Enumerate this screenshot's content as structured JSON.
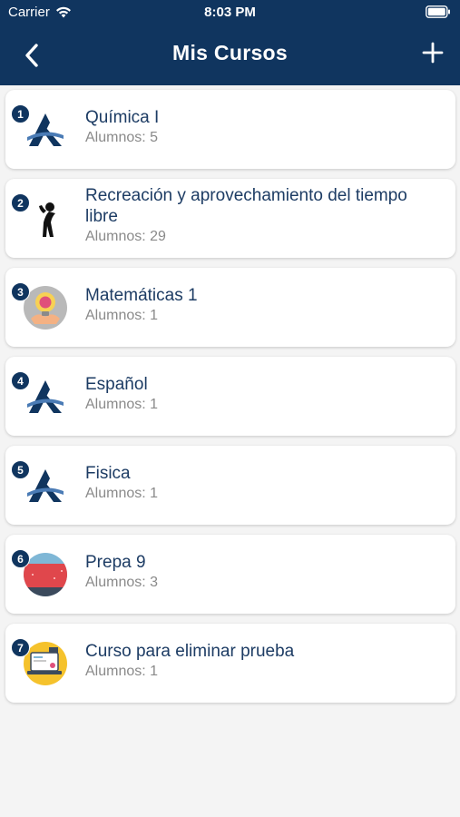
{
  "status_bar": {
    "carrier": "Carrier",
    "time": "8:03 PM",
    "wifi_icon": "wifi-icon",
    "battery_icon": "battery-icon"
  },
  "nav": {
    "title": "Mis Cursos",
    "back_icon": "chevron-left-icon",
    "add_icon": "plus-icon"
  },
  "colors": {
    "header_bg": "#10355f",
    "badge_bg": "#10355f",
    "course_name": "#1d3c64",
    "course_students": "#8a8a8a",
    "page_bg": "#f4f4f4"
  },
  "courses": [
    {
      "number": "1",
      "name": "Química I",
      "students": "Alumnos: 5",
      "icon": "logo-a-icon"
    },
    {
      "number": "2",
      "name": "Recreación y aprovechamiento del tiempo libre",
      "students": "Alumnos: 29",
      "icon": "stretching-person-icon"
    },
    {
      "number": "3",
      "name": "Matemáticas 1",
      "students": "Alumnos: 1",
      "icon": "brain-lightbulb-icon"
    },
    {
      "number": "4",
      "name": "Español",
      "students": "Alumnos: 1",
      "icon": "logo-a-icon"
    },
    {
      "number": "5",
      "name": "Fisica",
      "students": "Alumnos: 1",
      "icon": "logo-a-icon"
    },
    {
      "number": "6",
      "name": "Prepa 9",
      "students": "Alumnos: 3",
      "icon": "red-banner-icon"
    },
    {
      "number": "7",
      "name": "Curso para eliminar prueba",
      "students": "Alumnos: 1",
      "icon": "laptop-icon"
    }
  ]
}
